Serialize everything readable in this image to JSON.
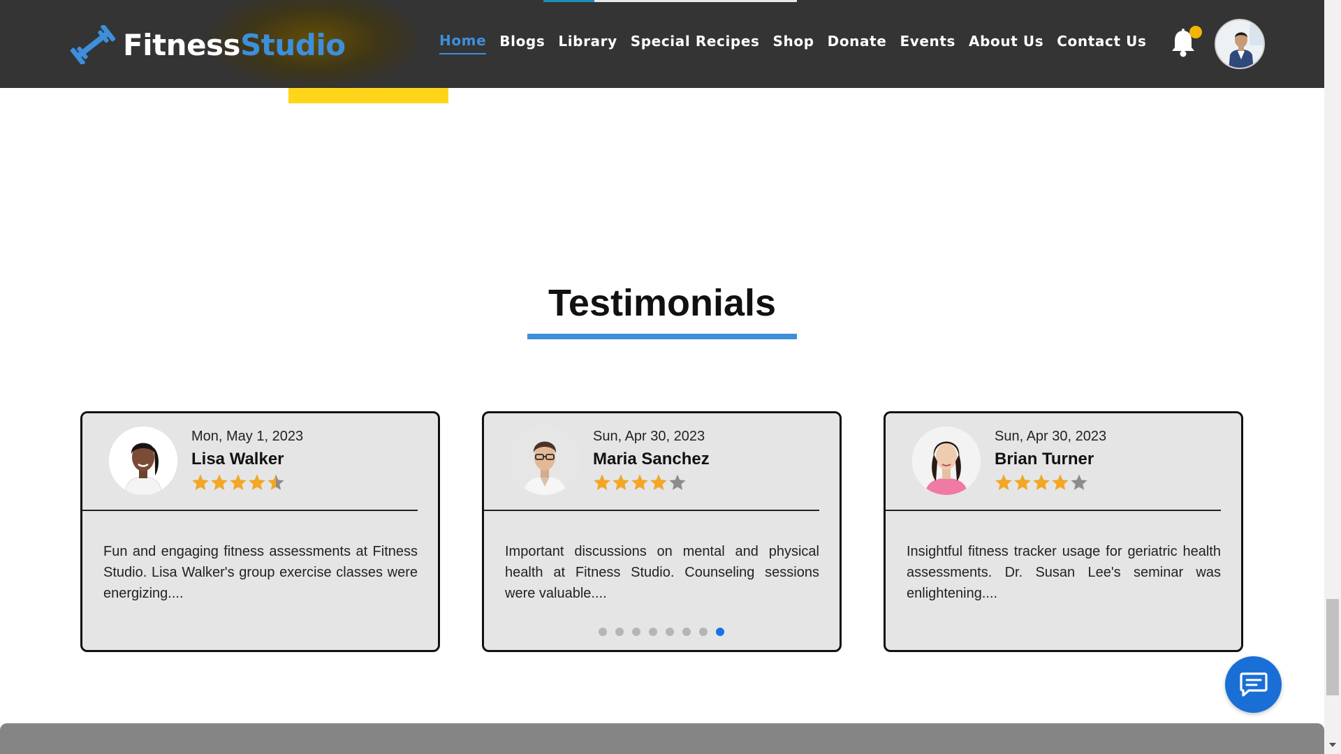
{
  "header": {
    "logo": {
      "part1": "Fitness",
      "part2": "Studio",
      "icon": "dumbbell-icon"
    },
    "nav": [
      {
        "label": "Home",
        "active": true
      },
      {
        "label": "Blogs"
      },
      {
        "label": "Library"
      },
      {
        "label": "Special Recipes"
      },
      {
        "label": "Shop"
      },
      {
        "label": "Donate"
      },
      {
        "label": "Events"
      },
      {
        "label": "About Us"
      },
      {
        "label": "Contact Us"
      }
    ],
    "notification_icon": "bell-icon",
    "profile_icon": "user-avatar"
  },
  "testimonials": {
    "title": "Testimonials",
    "cards": [
      {
        "date": "Mon, May 1, 2023",
        "name": "Lisa Walker",
        "rating": 4.5,
        "text": "Fun and engaging fitness assessments at Fitness Studio. Lisa Walker's group exercise classes were energizing...."
      },
      {
        "date": "Sun, Apr 30, 2023",
        "name": "Maria Sanchez",
        "rating": 4,
        "text": "Important discussions on mental and physical health at Fitness Studio. Counseling sessions were valuable...."
      },
      {
        "date": "Sun, Apr 30, 2023",
        "name": "Brian Turner",
        "rating": 4,
        "text": "Insightful fitness tracker usage for geriatric health assessments. Dr. Susan Lee's seminar was enlightening...."
      }
    ],
    "pagination": {
      "count": 8,
      "active_index": 7
    }
  },
  "chat": {
    "icon": "chat-icon"
  },
  "colors": {
    "header_bg": "#343434",
    "accent_blue": "#3d8fdc",
    "star_gold": "#f5a623",
    "star_gray": "#8c8c8c",
    "notification_dot": "#f5b400",
    "chat_blue": "#1a6fd6"
  }
}
